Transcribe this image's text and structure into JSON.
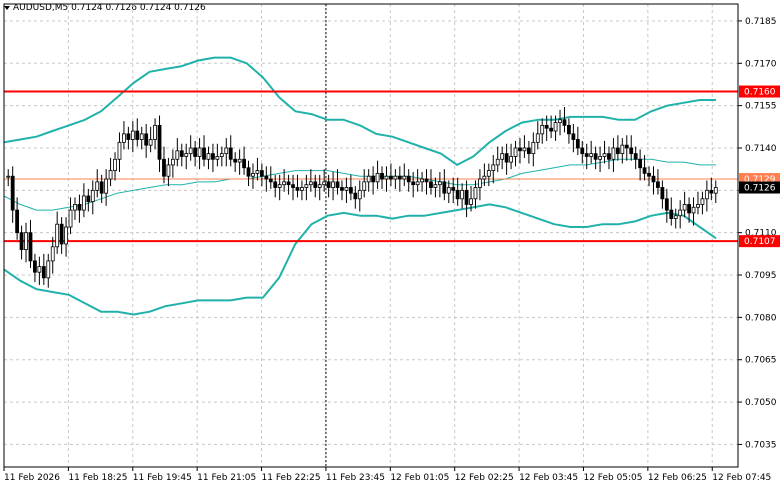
{
  "header": {
    "symbol_line": "AUDUSD,M5  0.7124 0.7126 0.7124 0.7126"
  },
  "colors": {
    "background": "#ffffff",
    "grid": "#c8c8c8",
    "axis": "#000000",
    "candle_bull": "#ffffff",
    "candle_bear": "#000000",
    "bollinger": "#20b2aa",
    "support_resistance": "#ff0000",
    "bid_line": "#ff7f50"
  },
  "chart_data": {
    "type": "candlestick",
    "symbol": "AUDUSD",
    "timeframe": "M5",
    "y_ticks": [
      0.7185,
      0.717,
      0.7155,
      0.714,
      0.7125,
      0.711,
      0.7095,
      0.708,
      0.7065,
      0.705,
      0.7035
    ],
    "y_tick_labels": [
      "0.7185",
      "0.7170",
      "0.7155",
      "0.7140",
      "0.7125",
      "0.7110",
      "0.7095",
      "0.7080",
      "0.7065",
      "0.7050",
      "0.7035"
    ],
    "ylim": [
      0.7027,
      0.7191
    ],
    "x_tick_labels": [
      "11 Feb 2026",
      "11 Feb 18:25",
      "11 Feb 19:45",
      "11 Feb 21:05",
      "11 Feb 22:25",
      "11 Feb 23:45",
      "12 Feb 01:05",
      "12 Feb 02:25",
      "12 Feb 03:45",
      "12 Feb 05:05",
      "12 Feb 06:25",
      "12 Feb 07:45"
    ],
    "horizontal_lines": [
      {
        "label": "0.7160",
        "value": 0.716,
        "kind": "resistance"
      },
      {
        "label": "0.7129",
        "value": 0.7129,
        "kind": "bid"
      },
      {
        "label": "0.7107",
        "value": 0.7107,
        "kind": "support"
      }
    ],
    "current_price_label": "0.7126",
    "current_price": 0.7126,
    "candle_count": 138,
    "candles_close": [
      0.713,
      0.7118,
      0.711,
      0.7104,
      0.711,
      0.71,
      0.7096,
      0.7098,
      0.7094,
      0.71,
      0.7105,
      0.7113,
      0.7106,
      0.7112,
      0.7118,
      0.712,
      0.7118,
      0.7123,
      0.7121,
      0.7125,
      0.7128,
      0.7124,
      0.7129,
      0.7132,
      0.7136,
      0.7142,
      0.7145,
      0.7143,
      0.7146,
      0.7143,
      0.7145,
      0.7141,
      0.7143,
      0.7148,
      0.7136,
      0.713,
      0.7134,
      0.7136,
      0.7139,
      0.7137,
      0.7138,
      0.714,
      0.7137,
      0.714,
      0.7136,
      0.7138,
      0.7136,
      0.7137,
      0.7138,
      0.714,
      0.7136,
      0.7135,
      0.7136,
      0.7133,
      0.713,
      0.7131,
      0.7132,
      0.713,
      0.7129,
      0.7128,
      0.7126,
      0.7127,
      0.7128,
      0.7127,
      0.7126,
      0.7125,
      0.7126,
      0.7127,
      0.7128,
      0.7126,
      0.7127,
      0.7128,
      0.7126,
      0.7128,
      0.7126,
      0.7125,
      0.7126,
      0.7124,
      0.7122,
      0.7125,
      0.7128,
      0.713,
      0.7128,
      0.7131,
      0.7129,
      0.713,
      0.7129,
      0.713,
      0.7129,
      0.713,
      0.7128,
      0.7127,
      0.7128,
      0.7129,
      0.7128,
      0.7126,
      0.7127,
      0.7128,
      0.7124,
      0.7126,
      0.7125,
      0.7122,
      0.7125,
      0.712,
      0.7122,
      0.7126,
      0.7129,
      0.713,
      0.7132,
      0.7134,
      0.7136,
      0.7138,
      0.7135,
      0.7137,
      0.714,
      0.7139,
      0.714,
      0.7138,
      0.7142,
      0.7145,
      0.7148,
      0.7147,
      0.7146,
      0.7149,
      0.715,
      0.7148,
      0.7145,
      0.7143,
      0.714,
      0.7138,
      0.7137,
      0.7138,
      0.7136,
      0.7137,
      0.7138,
      0.7136,
      0.714,
      0.7138
    ],
    "tail_closes": [
      0.7141,
      0.714,
      0.7138,
      0.7136,
      0.7133,
      0.7131,
      0.713,
      0.7128,
      0.7126,
      0.7122,
      0.7118,
      0.7115,
      0.7116,
      0.7118,
      0.712,
      0.7117,
      0.7119,
      0.712,
      0.7122,
      0.7125,
      0.7124,
      0.7126
    ],
    "bollinger_upper": [
      0.7142,
      0.7143,
      0.7144,
      0.7146,
      0.7148,
      0.715,
      0.7153,
      0.7158,
      0.7163,
      0.7167,
      0.7168,
      0.7169,
      0.7171,
      0.7172,
      0.7172,
      0.717,
      0.7165,
      0.7158,
      0.7153,
      0.7152,
      0.715,
      0.715,
      0.7148,
      0.7145,
      0.7144,
      0.7142,
      0.714,
      0.7138,
      0.7134,
      0.7137,
      0.7142,
      0.7146,
      0.7149,
      0.715,
      0.715,
      0.7151,
      0.7151,
      0.7151,
      0.715,
      0.715,
      0.7153,
      0.7155,
      0.7156,
      0.7157,
      0.7157
    ],
    "bollinger_middle": [
      0.7123,
      0.712,
      0.7118,
      0.7118,
      0.7119,
      0.712,
      0.7122,
      0.7124,
      0.7125,
      0.7126,
      0.7127,
      0.7127,
      0.7128,
      0.7128,
      0.7129,
      0.7129,
      0.713,
      0.7131,
      0.7132,
      0.7132,
      0.7132,
      0.7131,
      0.713,
      0.713,
      0.713,
      0.713,
      0.7129,
      0.7128,
      0.7127,
      0.7127,
      0.7128,
      0.7129,
      0.7131,
      0.7132,
      0.7133,
      0.7134,
      0.7134,
      0.7135,
      0.7136,
      0.7136,
      0.7136,
      0.7135,
      0.7135,
      0.7134,
      0.7134
    ],
    "bollinger_lower": [
      0.7097,
      0.7093,
      0.709,
      0.7089,
      0.7088,
      0.7085,
      0.7082,
      0.7082,
      0.7081,
      0.7082,
      0.7084,
      0.7085,
      0.7086,
      0.7086,
      0.7086,
      0.7087,
      0.7087,
      0.7094,
      0.7106,
      0.7113,
      0.7116,
      0.7117,
      0.7116,
      0.7116,
      0.7115,
      0.7116,
      0.7116,
      0.7117,
      0.7118,
      0.7119,
      0.712,
      0.7119,
      0.7117,
      0.7115,
      0.7113,
      0.7112,
      0.7112,
      0.7113,
      0.7113,
      0.7114,
      0.7116,
      0.7117,
      0.7116,
      0.7112,
      0.7108
    ],
    "vertical_separator_label": "11 Feb 23:45",
    "grid": true,
    "axis_position": "right"
  }
}
